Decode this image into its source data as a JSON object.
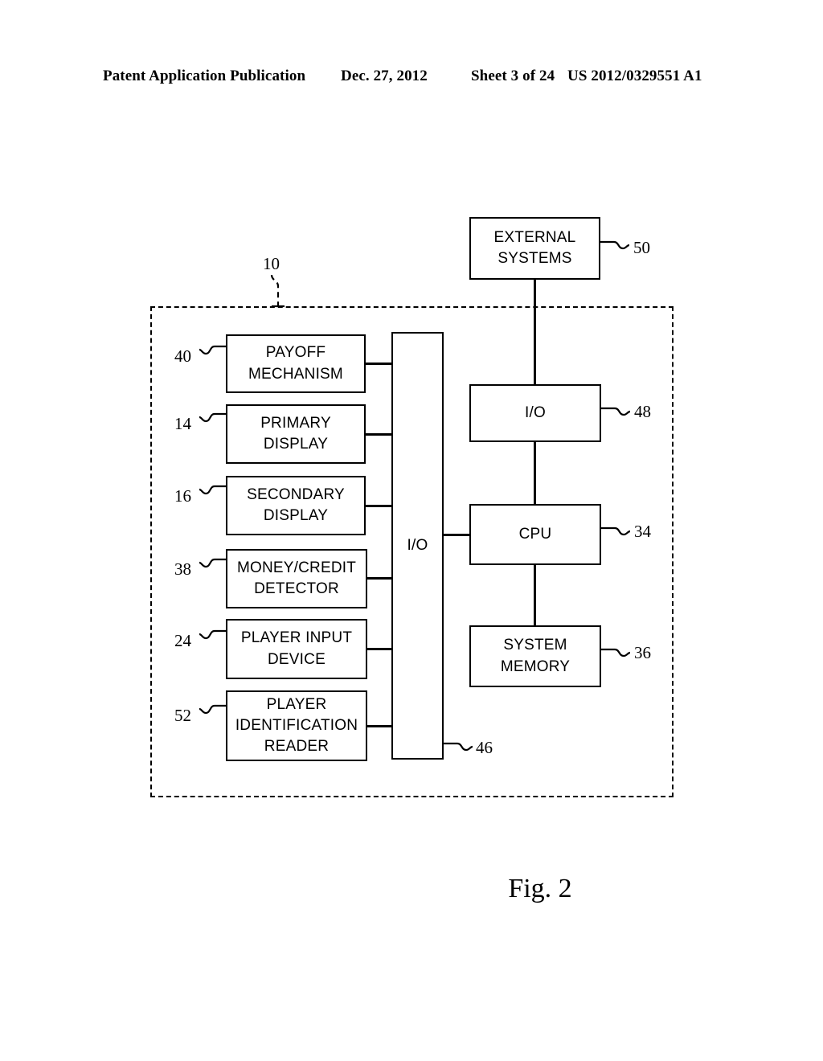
{
  "header": {
    "publication": "Patent Application Publication",
    "date": "Dec. 27, 2012",
    "sheet": "Sheet 3 of 24",
    "patent_number": "US 2012/0329551 A1"
  },
  "figure": {
    "caption": "Fig. 2",
    "enclosure_ref": "10"
  },
  "blocks": {
    "external_systems": {
      "line1": "EXTERNAL",
      "line2": "SYSTEMS",
      "ref": "50"
    },
    "payoff_mechanism": {
      "line1": "PAYOFF",
      "line2": "MECHANISM",
      "ref": "40"
    },
    "primary_display": {
      "line1": "PRIMARY",
      "line2": "DISPLAY",
      "ref": "14"
    },
    "secondary_display": {
      "line1": "SECONDARY",
      "line2": "DISPLAY",
      "ref": "16"
    },
    "money_credit_detector": {
      "line1": "MONEY/CREDIT",
      "line2": "DETECTOR",
      "ref": "38"
    },
    "player_input_device": {
      "line1": "PLAYER INPUT",
      "line2": "DEVICE",
      "ref": "24"
    },
    "player_identification_reader": {
      "line1": "PLAYER",
      "line2": "IDENTIFICATION",
      "line3": "READER",
      "ref": "52"
    },
    "io_bus": {
      "line1": "I/O",
      "ref": "46"
    },
    "io_interface": {
      "line1": "I/O",
      "ref": "48"
    },
    "cpu": {
      "line1": "CPU",
      "ref": "34"
    },
    "system_memory": {
      "line1": "SYSTEM",
      "line2": "MEMORY",
      "ref": "36"
    }
  },
  "colors": {
    "ink": "#000000",
    "paper": "#ffffff"
  }
}
